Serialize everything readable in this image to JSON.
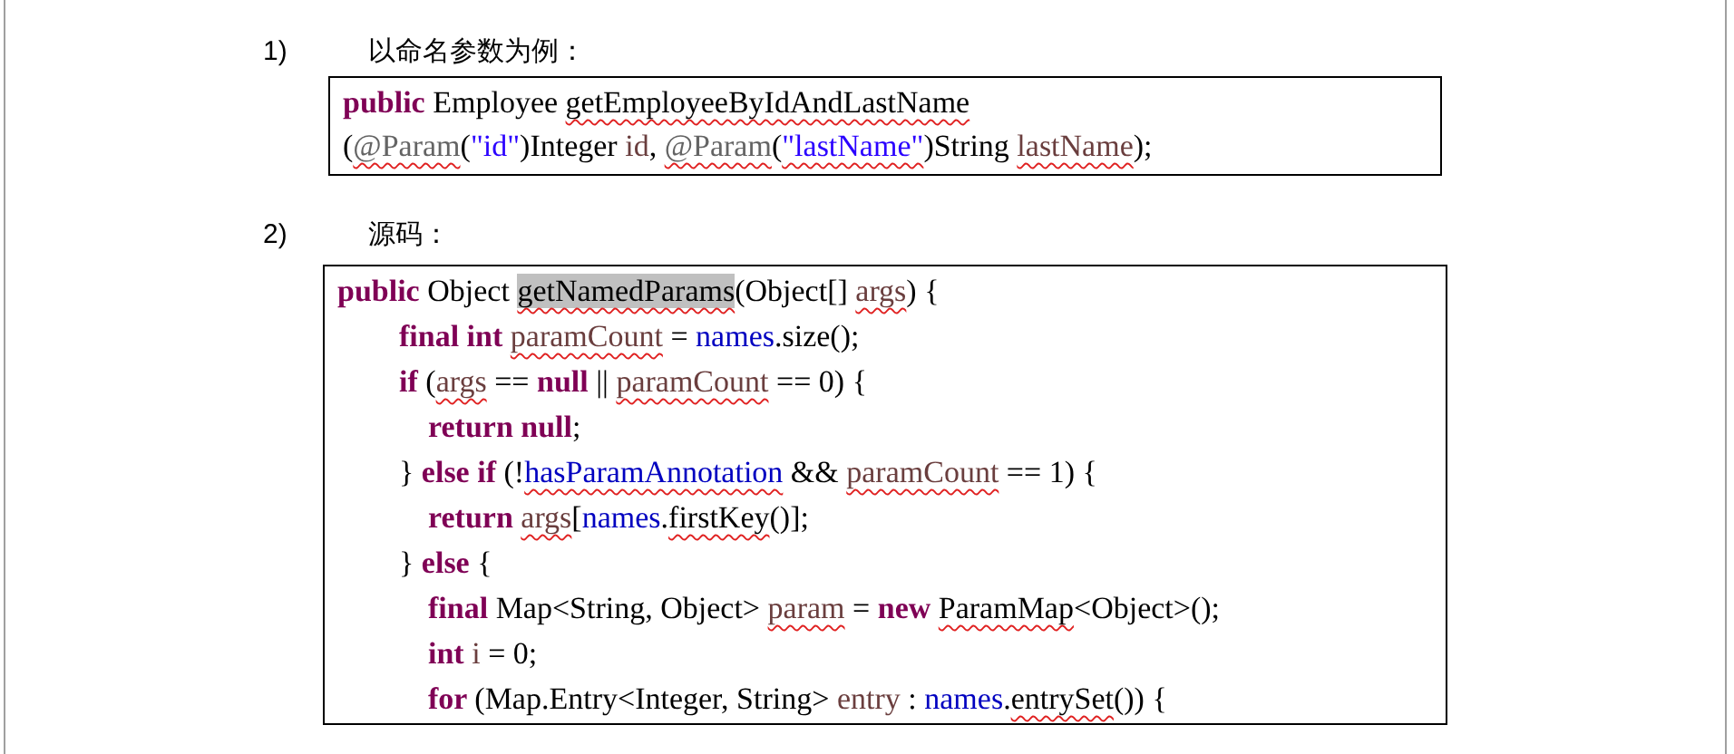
{
  "items": [
    {
      "number": "1)",
      "label": "以命名参数为例：",
      "code_box": {
        "lines": [
          {
            "tokens": [
              {
                "text": "public ",
                "kind": "keyword",
                "squiggle": false
              },
              {
                "text": "Employee ",
                "kind": "plain",
                "squiggle": false
              },
              {
                "text": "getEmployeeByIdAndLastName",
                "kind": "plain",
                "squiggle": true
              }
            ]
          },
          {
            "tokens": [
              {
                "text": "(",
                "kind": "plain",
                "squiggle": false
              },
              {
                "text": "@Param",
                "kind": "annotation",
                "squiggle": true
              },
              {
                "text": "(",
                "kind": "plain",
                "squiggle": false
              },
              {
                "text": "\"id\"",
                "kind": "string",
                "squiggle": false
              },
              {
                "text": ")Integer ",
                "kind": "plain",
                "squiggle": false
              },
              {
                "text": "id",
                "kind": "variable",
                "squiggle": false
              },
              {
                "text": ", ",
                "kind": "plain",
                "squiggle": false
              },
              {
                "text": "@Param",
                "kind": "annotation",
                "squiggle": true
              },
              {
                "text": "(",
                "kind": "plain",
                "squiggle": false
              },
              {
                "text": "\"lastName\"",
                "kind": "string",
                "squiggle": true
              },
              {
                "text": ")String ",
                "kind": "plain",
                "squiggle": false
              },
              {
                "text": "lastName",
                "kind": "variable",
                "squiggle": true
              },
              {
                "text": ");",
                "kind": "plain",
                "squiggle": false
              }
            ]
          }
        ]
      }
    },
    {
      "number": "2)",
      "label": "源码：",
      "code_box": {
        "lines": [
          {
            "tokens": [
              {
                "text": "public ",
                "kind": "keyword",
                "squiggle": false
              },
              {
                "text": "Object ",
                "kind": "plain",
                "squiggle": false
              },
              {
                "text": "getNamedParams",
                "kind": "plain",
                "squiggle": true,
                "highlighted": true
              },
              {
                "text": "(Object[] ",
                "kind": "plain",
                "squiggle": false
              },
              {
                "text": "args",
                "kind": "variable",
                "squiggle": true
              },
              {
                "text": ") {",
                "kind": "plain",
                "squiggle": false
              }
            ],
            "children": [
              {
                "tokens": [
                  {
                    "text": "final int ",
                    "kind": "keyword",
                    "squiggle": false
                  },
                  {
                    "text": "paramCount",
                    "kind": "variable",
                    "squiggle": true
                  },
                  {
                    "text": " = ",
                    "kind": "plain",
                    "squiggle": false
                  },
                  {
                    "text": "names",
                    "kind": "field",
                    "squiggle": false
                  },
                  {
                    "text": ".size();",
                    "kind": "plain",
                    "squiggle": false
                  }
                ]
              },
              {
                "tokens": [
                  {
                    "text": "if ",
                    "kind": "keyword",
                    "squiggle": false
                  },
                  {
                    "text": "(",
                    "kind": "plain",
                    "squiggle": false
                  },
                  {
                    "text": "args",
                    "kind": "variable",
                    "squiggle": true
                  },
                  {
                    "text": " == ",
                    "kind": "plain",
                    "squiggle": false
                  },
                  {
                    "text": "null",
                    "kind": "keyword",
                    "squiggle": false
                  },
                  {
                    "text": " || ",
                    "kind": "plain",
                    "squiggle": false
                  },
                  {
                    "text": "paramCount",
                    "kind": "variable",
                    "squiggle": true
                  },
                  {
                    "text": " == 0) {",
                    "kind": "plain",
                    "squiggle": false
                  }
                ],
                "children": [
                  {
                    "tokens": [
                      {
                        "text": "return null",
                        "kind": "keyword",
                        "squiggle": false
                      },
                      {
                        "text": ";",
                        "kind": "plain",
                        "squiggle": false
                      }
                    ]
                  }
                ]
              },
              {
                "tokens": [
                  {
                    "text": "} ",
                    "kind": "plain",
                    "squiggle": false
                  },
                  {
                    "text": "else if ",
                    "kind": "keyword",
                    "squiggle": false
                  },
                  {
                    "text": "(!",
                    "kind": "plain",
                    "squiggle": false
                  },
                  {
                    "text": "hasParamAnnotation",
                    "kind": "field",
                    "squiggle": true
                  },
                  {
                    "text": " && ",
                    "kind": "plain",
                    "squiggle": false
                  },
                  {
                    "text": "paramCount",
                    "kind": "variable",
                    "squiggle": true
                  },
                  {
                    "text": " == 1) {",
                    "kind": "plain",
                    "squiggle": false
                  }
                ],
                "children": [
                  {
                    "tokens": [
                      {
                        "text": "return ",
                        "kind": "keyword",
                        "squiggle": false
                      },
                      {
                        "text": "args",
                        "kind": "variable",
                        "squiggle": true
                      },
                      {
                        "text": "[",
                        "kind": "plain",
                        "squiggle": false
                      },
                      {
                        "text": "names",
                        "kind": "field",
                        "squiggle": false
                      },
                      {
                        "text": ".",
                        "kind": "plain"
                      },
                      {
                        "text": "firstKey",
                        "kind": "plain",
                        "squiggle": true
                      },
                      {
                        "text": "()];",
                        "kind": "plain",
                        "squiggle": false
                      }
                    ]
                  }
                ]
              },
              {
                "tokens": [
                  {
                    "text": "} ",
                    "kind": "plain",
                    "squiggle": false
                  },
                  {
                    "text": "else ",
                    "kind": "keyword",
                    "squiggle": false
                  },
                  {
                    "text": "{",
                    "kind": "plain",
                    "squiggle": false
                  }
                ],
                "children": [
                  {
                    "tokens": [
                      {
                        "text": "final ",
                        "kind": "keyword",
                        "squiggle": false
                      },
                      {
                        "text": "Map<String, Object> ",
                        "kind": "plain",
                        "squiggle": false
                      },
                      {
                        "text": "param",
                        "kind": "variable",
                        "squiggle": true
                      },
                      {
                        "text": " = ",
                        "kind": "plain",
                        "squiggle": false
                      },
                      {
                        "text": "new ",
                        "kind": "keyword",
                        "squiggle": false
                      },
                      {
                        "text": "ParamMap",
                        "kind": "plain",
                        "squiggle": true
                      },
                      {
                        "text": "<Object>();",
                        "kind": "plain",
                        "squiggle": false
                      }
                    ]
                  },
                  {
                    "tokens": [
                      {
                        "text": "int ",
                        "kind": "keyword",
                        "squiggle": false
                      },
                      {
                        "text": "i",
                        "kind": "variable",
                        "squiggle": false
                      },
                      {
                        "text": " = 0;",
                        "kind": "plain",
                        "squiggle": false
                      }
                    ]
                  },
                  {
                    "tokens": [
                      {
                        "text": "for ",
                        "kind": "keyword",
                        "squiggle": false
                      },
                      {
                        "text": "(Map.Entry<Integer, String> ",
                        "kind": "plain",
                        "squiggle": false
                      },
                      {
                        "text": "entry",
                        "kind": "variable",
                        "squiggle": false
                      },
                      {
                        "text": " : ",
                        "kind": "plain",
                        "squiggle": false
                      },
                      {
                        "text": "names",
                        "kind": "field",
                        "squiggle": false
                      },
                      {
                        "text": ".",
                        "kind": "plain"
                      },
                      {
                        "text": "entrySet",
                        "kind": "plain",
                        "squiggle": true
                      },
                      {
                        "text": "()) {",
                        "kind": "plain",
                        "squiggle": false
                      }
                    ]
                  }
                ]
              }
            ]
          }
        ]
      }
    }
  ]
}
